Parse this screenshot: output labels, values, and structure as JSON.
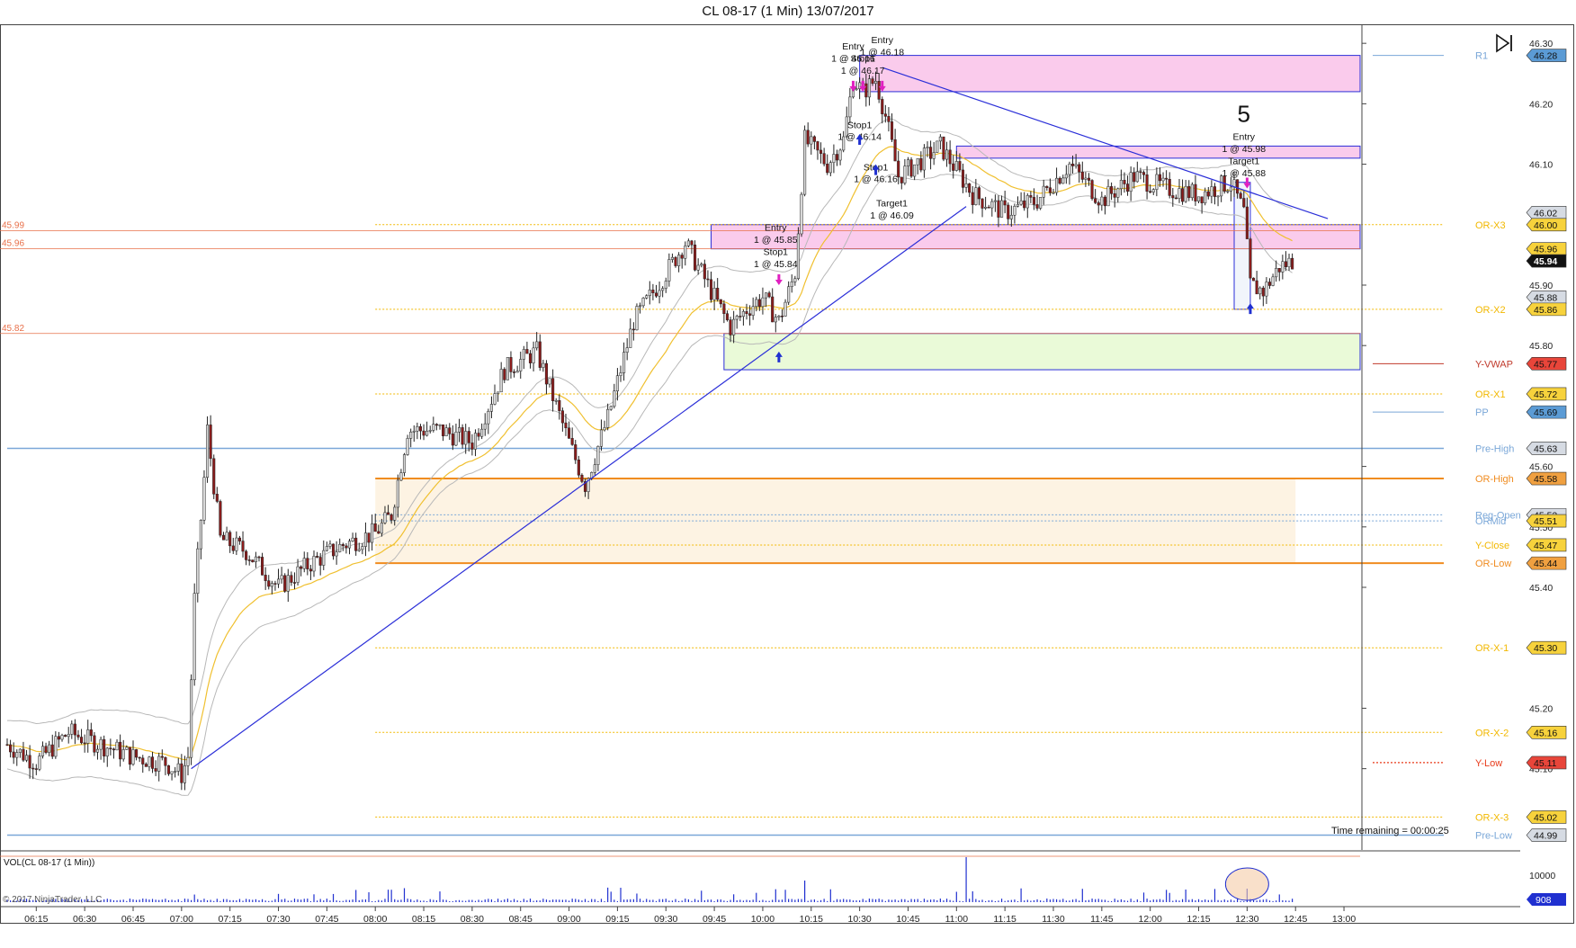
{
  "title": "CL 08-17 (1 Min)  13/07/2017",
  "time_remaining": "Time remaining = 00:00:25",
  "volume_label": "VOL(CL 08-17 (1 Min))",
  "copyright": "© 2017 NinjaTrader, LLC",
  "end_button_icon": "skip-to-end-icon",
  "colors": {
    "price_band": "#f5a0dc",
    "support_band": "#d8f5b8",
    "opening_range": "#fdf2e0",
    "trendline": "#2b2fd8",
    "vwap": "#f0c030",
    "envelope": "#b8b8b8",
    "level_orange": "#f08c20",
    "level_gold": "#f2b800",
    "level_blue": "#7aa7d8"
  },
  "chart_data": {
    "type": "candlestick",
    "instrument": "CL 08-17",
    "interval": "1 Min",
    "date": "13/07/2017",
    "x_ticks": [
      "06:15",
      "06:30",
      "06:45",
      "07:00",
      "07:15",
      "07:30",
      "07:45",
      "08:00",
      "08:15",
      "08:30",
      "08:45",
      "09:00",
      "09:15",
      "09:30",
      "09:45",
      "10:00",
      "10:15",
      "10:30",
      "10:45",
      "11:00",
      "11:15",
      "11:30",
      "11:45",
      "12:00",
      "12:15",
      "12:30",
      "12:45",
      "13:00"
    ],
    "y_ticks": [
      46.3,
      46.2,
      46.1,
      45.9,
      45.8,
      45.6,
      45.5,
      45.4,
      45.2,
      45.1
    ],
    "ylim": [
      44.97,
      46.33
    ],
    "xlim": [
      "06:06",
      "13:05"
    ],
    "grid": false,
    "price_path": [
      [
        "06:06",
        45.14
      ],
      [
        "06:15",
        45.11
      ],
      [
        "06:25",
        45.16
      ],
      [
        "06:35",
        45.14
      ],
      [
        "06:45",
        45.12
      ],
      [
        "06:55",
        45.11
      ],
      [
        "07:00",
        45.09
      ],
      [
        "07:02",
        45.12
      ],
      [
        "07:04",
        45.38
      ],
      [
        "07:07",
        45.58
      ],
      [
        "07:08",
        45.66
      ],
      [
        "07:12",
        45.48
      ],
      [
        "07:20",
        45.46
      ],
      [
        "07:30",
        45.4
      ],
      [
        "07:40",
        45.44
      ],
      [
        "07:50",
        45.47
      ],
      [
        "08:00",
        45.49
      ],
      [
        "08:05",
        45.52
      ],
      [
        "08:10",
        45.66
      ],
      [
        "08:20",
        45.66
      ],
      [
        "08:30",
        45.64
      ],
      [
        "08:40",
        45.76
      ],
      [
        "08:50",
        45.79
      ],
      [
        "09:00",
        45.64
      ],
      [
        "09:05",
        45.57
      ],
      [
        "09:12",
        45.68
      ],
      [
        "09:20",
        45.84
      ],
      [
        "09:30",
        45.92
      ],
      [
        "09:36",
        45.97
      ],
      [
        "09:45",
        45.88
      ],
      [
        "09:50",
        45.83
      ],
      [
        "09:55",
        45.86
      ],
      [
        "10:00",
        45.88
      ],
      [
        "10:05",
        45.84
      ],
      [
        "10:10",
        45.92
      ],
      [
        "10:13",
        46.14
      ],
      [
        "10:20",
        46.1
      ],
      [
        "10:25",
        46.14
      ],
      [
        "10:28",
        46.24
      ],
      [
        "10:31",
        46.22
      ],
      [
        "10:35",
        46.24
      ],
      [
        "10:38",
        46.18
      ],
      [
        "10:42",
        46.08
      ],
      [
        "10:50",
        46.11
      ],
      [
        "10:55",
        46.13
      ],
      [
        "11:05",
        46.05
      ],
      [
        "11:15",
        46.02
      ],
      [
        "11:25",
        46.04
      ],
      [
        "11:35",
        46.1
      ],
      [
        "11:45",
        46.04
      ],
      [
        "11:55",
        46.08
      ],
      [
        "12:05",
        46.06
      ],
      [
        "12:15",
        46.05
      ],
      [
        "12:25",
        46.07
      ],
      [
        "12:29",
        46.02
      ],
      [
        "12:31",
        45.9
      ],
      [
        "12:35",
        45.89
      ],
      [
        "12:40",
        45.93
      ],
      [
        "12:44",
        45.94
      ]
    ],
    "last_price": 45.94,
    "price_markers_left": [
      45.99,
      45.96,
      45.82
    ],
    "levels": [
      {
        "name": "R1",
        "value": 46.28
      },
      {
        "name": "OR-X3",
        "value": 46.0
      },
      {
        "name": "OR-X2",
        "value": 45.86
      },
      {
        "name": "Y-VWAP",
        "value": 45.77
      },
      {
        "name": "OR-X1",
        "value": 45.72
      },
      {
        "name": "PP",
        "value": 45.69
      },
      {
        "name": "Pre-High",
        "value": 45.63
      },
      {
        "name": "OR-High",
        "value": 45.58
      },
      {
        "name": "Reg-Open",
        "value": 45.52
      },
      {
        "name": "ORMid",
        "value": 45.51
      },
      {
        "name": "Y-Close",
        "value": 45.47
      },
      {
        "name": "OR-Low",
        "value": 45.44
      },
      {
        "name": "OR-X-1",
        "value": 45.3
      },
      {
        "name": "OR-X-2",
        "value": 45.16
      },
      {
        "name": "Y-Low",
        "value": 45.11
      },
      {
        "name": "OR-X-3",
        "value": 45.02
      },
      {
        "name": "Pre-Low",
        "value": 44.99
      }
    ],
    "right_labels": [
      "46.28",
      "46.02",
      "46.00",
      "45.96",
      "45.94",
      "45.88",
      "45.86",
      "45.77",
      "45.72",
      "45.69",
      "45.63",
      "45.58",
      "45.52",
      "45.51",
      "45.47",
      "45.44",
      "45.30",
      "45.16",
      "45.11",
      "45.02",
      "44.99"
    ],
    "zones": [
      {
        "from": "10:30",
        "to": "13:05",
        "low": 46.22,
        "high": 46.28
      },
      {
        "from": "11:00",
        "to": "13:05",
        "low": 46.11,
        "high": 46.13
      },
      {
        "from": "09:44",
        "to": "13:05",
        "low": 45.96,
        "high": 46.0
      },
      {
        "from": "09:48",
        "to": "13:05",
        "low": 45.76,
        "high": 45.82
      },
      {
        "from": "08:00",
        "to": "12:45",
        "low": 45.44,
        "high": 45.58
      }
    ],
    "trade_box": {
      "from": "12:26",
      "to": "12:31",
      "low": 45.86,
      "high": 46.07
    },
    "trendlines": [
      {
        "from": [
          "07:03",
          45.1
        ],
        "to": [
          "11:03",
          46.03
        ]
      },
      {
        "from": [
          "10:37",
          46.26
        ],
        "to": [
          "12:55",
          46.01
        ]
      }
    ],
    "annotations": [
      {
        "text": "Entry",
        "time": "10:28",
        "price": 46.29
      },
      {
        "text": "1 @ 46.16",
        "time": "10:28",
        "price": 46.27
      },
      {
        "text": "Stop1",
        "time": "10:31",
        "price": 46.27
      },
      {
        "text": "1 @ 46.17",
        "time": "10:31",
        "price": 46.25
      },
      {
        "text": "Entry",
        "time": "10:37",
        "price": 46.3
      },
      {
        "text": "1 @ 46.18",
        "time": "10:37",
        "price": 46.28
      },
      {
        "text": "Stop1",
        "time": "10:30",
        "price": 46.16
      },
      {
        "text": "1 @ 46.14",
        "time": "10:30",
        "price": 46.14
      },
      {
        "text": "Stop1",
        "time": "10:35",
        "price": 46.09
      },
      {
        "text": "1 @ 46.16",
        "time": "10:35",
        "price": 46.07
      },
      {
        "text": "Target1",
        "time": "10:40",
        "price": 46.03
      },
      {
        "text": "1 @ 46.09",
        "time": "10:40",
        "price": 46.01
      },
      {
        "text": "Entry",
        "time": "10:04",
        "price": 45.99
      },
      {
        "text": "1 @ 45.85",
        "time": "10:04",
        "price": 45.97
      },
      {
        "text": "Stop1",
        "time": "10:04",
        "price": 45.95
      },
      {
        "text": "1 @ 45.84",
        "time": "10:04",
        "price": 45.93
      },
      {
        "text": "Entry",
        "time": "12:29",
        "price": 46.14
      },
      {
        "text": "1 @ 45.98",
        "time": "12:29",
        "price": 46.12
      },
      {
        "text": "Target1",
        "time": "12:29",
        "price": 46.1
      },
      {
        "text": "1 @ 45.88",
        "time": "12:29",
        "price": 46.08
      }
    ],
    "trade_count_label": "5",
    "volume": {
      "y_tick": "10000",
      "last_value": "908",
      "spike_time": "11:03"
    }
  }
}
